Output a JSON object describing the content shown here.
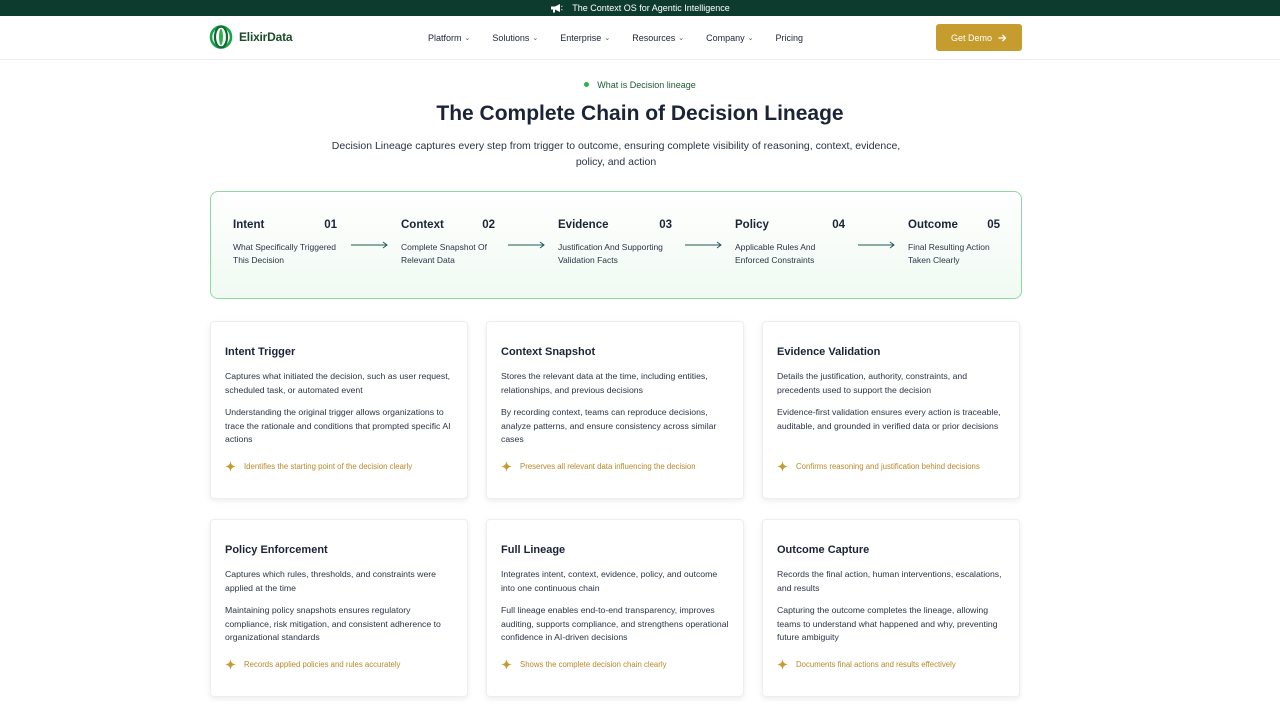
{
  "announcement": {
    "text": "The Context OS for Agentic Intelligence",
    "icon": "megaphone-icon"
  },
  "nav": {
    "logo_text": "ElixirData",
    "menu": [
      {
        "label": "Platform",
        "has_dropdown": true
      },
      {
        "label": "Solutions",
        "has_dropdown": true
      },
      {
        "label": "Enterprise",
        "has_dropdown": true
      },
      {
        "label": "Resources",
        "has_dropdown": true
      },
      {
        "label": "Company",
        "has_dropdown": true
      },
      {
        "label": "Pricing",
        "has_dropdown": false
      }
    ],
    "cta_label": "Get Demo"
  },
  "hero": {
    "eyebrow": "What is Decision lineage",
    "title": "The Complete Chain of Decision Lineage",
    "subtitle": "Decision Lineage captures every step from trigger to outcome, ensuring complete visibility of reasoning, context, evidence, policy, and action"
  },
  "chain": [
    {
      "name": "Intent",
      "num": "01",
      "desc": "What Specifically Triggered This Decision"
    },
    {
      "name": "Context",
      "num": "02",
      "desc": "Complete Snapshot Of Relevant Data"
    },
    {
      "name": "Evidence",
      "num": "03",
      "desc": "Justification And Supporting Validation Facts"
    },
    {
      "name": "Policy",
      "num": "04",
      "desc": "Applicable Rules And Enforced Constraints"
    },
    {
      "name": "Outcome",
      "num": "05",
      "desc": "Final Resulting Action Taken Clearly"
    }
  ],
  "cards": [
    {
      "title": "Intent Trigger",
      "p1": "Captures what initiated the decision, such as user request, scheduled task, or automated event",
      "p2": "Understanding the original trigger allows organizations to trace the rationale and conditions that prompted specific AI actions",
      "foot": "Identifies the starting point of the decision clearly"
    },
    {
      "title": "Context Snapshot",
      "p1": "Stores the relevant data at the time, including entities, relationships, and previous decisions",
      "p2": "By recording context, teams can reproduce decisions, analyze patterns, and ensure consistency across similar cases",
      "foot": "Preserves all relevant data influencing the decision"
    },
    {
      "title": "Evidence Validation",
      "p1": "Details the justification, authority, constraints, and precedents used to support the decision",
      "p2": "Evidence-first validation ensures every action is traceable, auditable, and grounded in verified data or prior decisions",
      "foot": "Confirms reasoning and justification behind decisions"
    },
    {
      "title": "Policy Enforcement",
      "p1": "Captures which rules, thresholds, and constraints were applied at the time",
      "p2": "Maintaining policy snapshots ensures regulatory compliance, risk mitigation, and consistent adherence to organizational standards",
      "foot": "Records applied policies and rules accurately"
    },
    {
      "title": "Full Lineage",
      "p1": "Integrates intent, context, evidence, policy, and outcome into one continuous chain",
      "p2": "Full lineage enables end-to-end transparency, improves auditing, supports compliance, and strengthens operational confidence in AI-driven decisions",
      "foot": "Shows the complete decision chain clearly"
    },
    {
      "title": "Outcome Capture",
      "p1": "Records the final action, human interventions, escalations, and results",
      "p2": "Capturing the outcome completes the lineage, allowing teams to understand what happened and why, preventing future ambiguity",
      "foot": "Documents final actions and results effectively"
    }
  ],
  "colors": {
    "announce_bg": "#0d3b2e",
    "accent_gold": "#c69c2e",
    "accent_green": "#2db14d",
    "chain_border": "#8fd9a3"
  }
}
